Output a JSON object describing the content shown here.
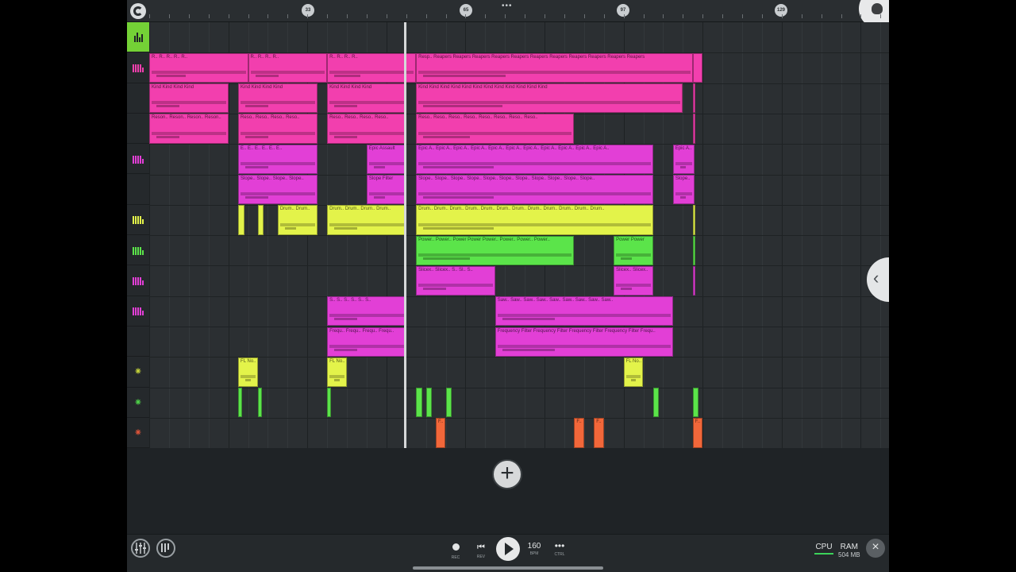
{
  "ruler": {
    "markers": [
      "33",
      "65",
      "97",
      "129"
    ],
    "menu_label": "•••"
  },
  "colors": {
    "pink": "#f23fae",
    "magenta": "#e23fd6",
    "yellow": "#e3f34a",
    "green": "#5be44a",
    "orange": "#f2673a",
    "master": "#74d136"
  },
  "tracks": [
    {
      "kind": "master",
      "icon": "mixer-icon"
    },
    {
      "kind": "piano",
      "icon": "piano-roll-icon",
      "color": "#f23fae"
    },
    {
      "kind": "automation",
      "icon": "",
      "color": "#f23fae"
    },
    {
      "kind": "automation",
      "icon": "",
      "color": "#f23fae"
    },
    {
      "kind": "piano",
      "icon": "piano-roll-icon",
      "color": "#e23fd6"
    },
    {
      "kind": "automation",
      "icon": "",
      "color": "#e23fd6"
    },
    {
      "kind": "piano",
      "icon": "piano-roll-icon",
      "color": "#e3f34a"
    },
    {
      "kind": "piano",
      "icon": "piano-roll-icon",
      "color": "#5be44a"
    },
    {
      "kind": "piano",
      "icon": "piano-roll-icon",
      "color": "#e23fd6"
    },
    {
      "kind": "piano",
      "icon": "piano-roll-icon",
      "color": "#e23fd6"
    },
    {
      "kind": "automation",
      "icon": "",
      "color": "#e23fd6"
    },
    {
      "kind": "audio",
      "icon": "audio-wave-icon",
      "color": "#c9d83a"
    },
    {
      "kind": "audio",
      "icon": "audio-wave-icon",
      "color": "#4fd64a"
    },
    {
      "kind": "audio",
      "icon": "audio-wave-icon",
      "color": "#e2553a"
    }
  ],
  "clips": [
    {
      "track": 1,
      "s": 0,
      "e": 5,
      "label": "R.. R.. R.. R.. R..",
      "color": "#f23fae"
    },
    {
      "track": 1,
      "s": 5,
      "e": 9,
      "label": "R.. R.. R.. R..",
      "color": "#f23fae"
    },
    {
      "track": 1,
      "s": 9,
      "e": 13.5,
      "label": "R.. R.. R.. R..",
      "color": "#f23fae"
    },
    {
      "track": 1,
      "s": 13.5,
      "e": 27.5,
      "label": "Resp.. Reapers Reapers Reapers Reapers Reapers Reapers Reapers Reapers Reapers Reapers Reapers",
      "color": "#f23fae"
    },
    {
      "track": 1,
      "s": 27.5,
      "e": 28,
      "label": "",
      "color": "#f23fae"
    },
    {
      "track": 2,
      "s": 0,
      "e": 4,
      "label": "Kind  Kind  Kind  Kind",
      "color": "#f23fae"
    },
    {
      "track": 2,
      "s": 4.5,
      "e": 8.5,
      "label": "Kind  Kind  Kind  Kind",
      "color": "#f23fae"
    },
    {
      "track": 2,
      "s": 9,
      "e": 13,
      "label": "Kind  Kind  Kind  Kind",
      "color": "#f23fae"
    },
    {
      "track": 2,
      "s": 13.5,
      "e": 27,
      "label": "Kind  Kind  Kind  Kind  Kind  Kind  Kind  Kind  Kind  Kind  Kind  Kind",
      "color": "#f23fae"
    },
    {
      "track": 2,
      "s": 27.5,
      "e": 27.6,
      "label": "",
      "color": "#f23fae"
    },
    {
      "track": 3,
      "s": 0,
      "e": 4,
      "label": "Reson.. Reson.. Reson.. Reson..",
      "color": "#f23fae"
    },
    {
      "track": 3,
      "s": 4.5,
      "e": 8.5,
      "label": "Reso.. Reso.. Reso.. Reso..",
      "color": "#f23fae"
    },
    {
      "track": 3,
      "s": 9,
      "e": 13,
      "label": "Reso.. Reso.. Reso.. Reso..",
      "color": "#f23fae"
    },
    {
      "track": 3,
      "s": 13.5,
      "e": 21.5,
      "label": "Reso.. Reso.. Reso.. Reso.. Reso.. Reso.. Reso.. Reso..",
      "color": "#f23fae"
    },
    {
      "track": 3,
      "s": 27.5,
      "e": 27.6,
      "label": "",
      "color": "#f23fae"
    },
    {
      "track": 4,
      "s": 4.5,
      "e": 8.5,
      "label": "E.. E.. E.. E.. E.. E..",
      "color": "#e23fd6"
    },
    {
      "track": 4,
      "s": 11,
      "e": 13,
      "label": "Epic Assault",
      "color": "#e23fd6"
    },
    {
      "track": 4,
      "s": 13.5,
      "e": 25.5,
      "label": "Epic A.. Epic A.. Epic A.. Epic A.. Epic A.. Epic A.. Epic A.. Epic A.. Epic A.. Epic A.. Epic A..",
      "color": "#e23fd6"
    },
    {
      "track": 4,
      "s": 26.5,
      "e": 27.6,
      "label": "Epic A..",
      "color": "#e23fd6"
    },
    {
      "track": 5,
      "s": 4.5,
      "e": 8.5,
      "label": "Slope.. Slope.. Slope.. Slope..",
      "color": "#e23fd6"
    },
    {
      "track": 5,
      "s": 11,
      "e": 13,
      "label": "Slope  Filter",
      "color": "#e23fd6"
    },
    {
      "track": 5,
      "s": 13.5,
      "e": 25.5,
      "label": "Slope.. Slope.. Slope.. Slope.. Slope.. Slope.. Slope.. Slope.. Slope.. Slope.. Slope..",
      "color": "#e23fd6"
    },
    {
      "track": 5,
      "s": 26.5,
      "e": 27.6,
      "label": "Slope..",
      "color": "#e23fd6"
    },
    {
      "track": 6,
      "s": 4.5,
      "e": 4.8,
      "label": "",
      "color": "#e3f34a"
    },
    {
      "track": 6,
      "s": 5.5,
      "e": 5.8,
      "label": "",
      "color": "#e3f34a"
    },
    {
      "track": 6,
      "s": 6.5,
      "e": 8.5,
      "label": "Drum.. Drum..",
      "color": "#e3f34a"
    },
    {
      "track": 6,
      "s": 9,
      "e": 13,
      "label": "Drum.. Drum.. Drum.. Drum..",
      "color": "#e3f34a"
    },
    {
      "track": 6,
      "s": 13.5,
      "e": 25.5,
      "label": "Drum.. Drum.. Drum.. Drum.. Drum.. Drum.. Drum.. Drum.. Drum.. Drum.. Drum.. Drum..",
      "color": "#e3f34a"
    },
    {
      "track": 6,
      "s": 27.5,
      "e": 27.6,
      "label": "",
      "color": "#e3f34a"
    },
    {
      "track": 7,
      "s": 13.5,
      "e": 21.5,
      "label": "Power.. Power.. Power Power Power.. Power.. Power.. Power..",
      "color": "#5be44a"
    },
    {
      "track": 7,
      "s": 23.5,
      "e": 25.5,
      "label": "Power Power",
      "color": "#5be44a"
    },
    {
      "track": 7,
      "s": 27.5,
      "e": 27.6,
      "label": "",
      "color": "#5be44a"
    },
    {
      "track": 8,
      "s": 13.5,
      "e": 17.5,
      "label": "Slicex.. Slicex.. S.. Sl.. S..",
      "color": "#e23fd6"
    },
    {
      "track": 8,
      "s": 23.5,
      "e": 25.5,
      "label": "Slicex.. Slicex..",
      "color": "#e23fd6"
    },
    {
      "track": 8,
      "s": 27.5,
      "e": 27.6,
      "label": "",
      "color": "#e23fd6"
    },
    {
      "track": 9,
      "s": 9,
      "e": 13,
      "label": "S.. S.. S.. S.. S.. S..",
      "color": "#e23fd6"
    },
    {
      "track": 9,
      "s": 17.5,
      "e": 26.5,
      "label": "Saw.. Saw.. Saw.. Saw.. Saw.. Saw.. Saw.. Saw.. Saw..",
      "color": "#e23fd6"
    },
    {
      "track": 10,
      "s": 9,
      "e": 13,
      "label": "Frequ.. Frequ.. Frequ.. Frequ..",
      "color": "#e23fd6"
    },
    {
      "track": 10,
      "s": 17.5,
      "e": 26.5,
      "label": "Frequency  Filter Frequency  Filter Frequency  Filter Frequency  Filter Frequ..",
      "color": "#e23fd6"
    },
    {
      "track": 11,
      "s": 4.5,
      "e": 5.5,
      "label": "FL No..",
      "color": "#e3f34a"
    },
    {
      "track": 11,
      "s": 9,
      "e": 10,
      "label": "FL No..",
      "color": "#e3f34a"
    },
    {
      "track": 11,
      "s": 24,
      "e": 25,
      "label": "FL No..",
      "color": "#e3f34a"
    },
    {
      "track": 12,
      "s": 4.5,
      "e": 4.7,
      "label": "",
      "color": "#5be44a"
    },
    {
      "track": 12,
      "s": 5.5,
      "e": 5.7,
      "label": "",
      "color": "#5be44a"
    },
    {
      "track": 12,
      "s": 9,
      "e": 9.2,
      "label": "",
      "color": "#5be44a"
    },
    {
      "track": 12,
      "s": 13.5,
      "e": 13.8,
      "label": "",
      "color": "#5be44a"
    },
    {
      "track": 12,
      "s": 14,
      "e": 14.3,
      "label": "",
      "color": "#5be44a"
    },
    {
      "track": 12,
      "s": 15,
      "e": 15.3,
      "label": "",
      "color": "#5be44a"
    },
    {
      "track": 12,
      "s": 25.5,
      "e": 25.8,
      "label": "",
      "color": "#5be44a"
    },
    {
      "track": 12,
      "s": 27.5,
      "e": 27.8,
      "label": "",
      "color": "#5be44a"
    },
    {
      "track": 13,
      "s": 14.5,
      "e": 15,
      "label": "F..",
      "color": "#f2673a"
    },
    {
      "track": 13,
      "s": 21.5,
      "e": 22,
      "label": "F..",
      "color": "#f2673a"
    },
    {
      "track": 13,
      "s": 22.5,
      "e": 23,
      "label": "F..",
      "color": "#f2673a"
    },
    {
      "track": 13,
      "s": 27.5,
      "e": 28,
      "label": "F..",
      "color": "#f2673a"
    }
  ],
  "playhead_bar": 12.9,
  "transport": {
    "rec_label": "REC",
    "rev_label": "REV",
    "bpm_value": "160",
    "bpm_label": "BPM",
    "ctrl_label": "CTRL"
  },
  "status": {
    "cpu_label": "CPU",
    "ram_label": "RAM",
    "ram_value": "504 MB"
  }
}
